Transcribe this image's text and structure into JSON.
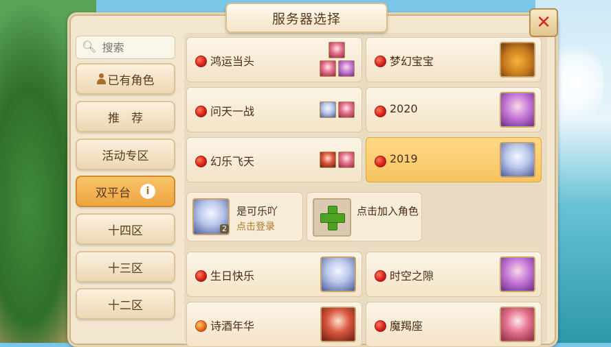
{
  "title": "服务器选择",
  "close_label": "✕",
  "search": {
    "placeholder": "搜索"
  },
  "sidebar": {
    "items": [
      {
        "label": "已有角色"
      },
      {
        "label": "推　荐"
      },
      {
        "label": "活动专区"
      },
      {
        "label": "双平台",
        "active": true,
        "info": "i"
      },
      {
        "label": "十四区"
      },
      {
        "label": "十三区"
      },
      {
        "label": "十二区"
      }
    ]
  },
  "servers_top": [
    {
      "name": "鸿运当头",
      "status": "full"
    },
    {
      "name": "梦幻宝宝",
      "status": "full"
    },
    {
      "name": "问天一战",
      "status": "full"
    },
    {
      "name": "2020",
      "status": "full"
    },
    {
      "name": "幻乐飞天",
      "status": "full"
    },
    {
      "name": "2019",
      "status": "full",
      "selected": true
    }
  ],
  "my_role": {
    "name": "是可乐吖",
    "level": "2",
    "action": "点击登录"
  },
  "add_role": {
    "label": "点击加入角色"
  },
  "servers_bottom": [
    {
      "name": "生日快乐",
      "status": "full"
    },
    {
      "name": "时空之隙",
      "status": "full"
    },
    {
      "name": "诗酒年华",
      "status": "busy"
    },
    {
      "name": "魔羯座",
      "status": "full"
    }
  ],
  "colors": {
    "status_full": "#d9241b",
    "status_busy": "#e8701c",
    "selected": "#f6c45f",
    "active_tab": "#eea43f"
  }
}
